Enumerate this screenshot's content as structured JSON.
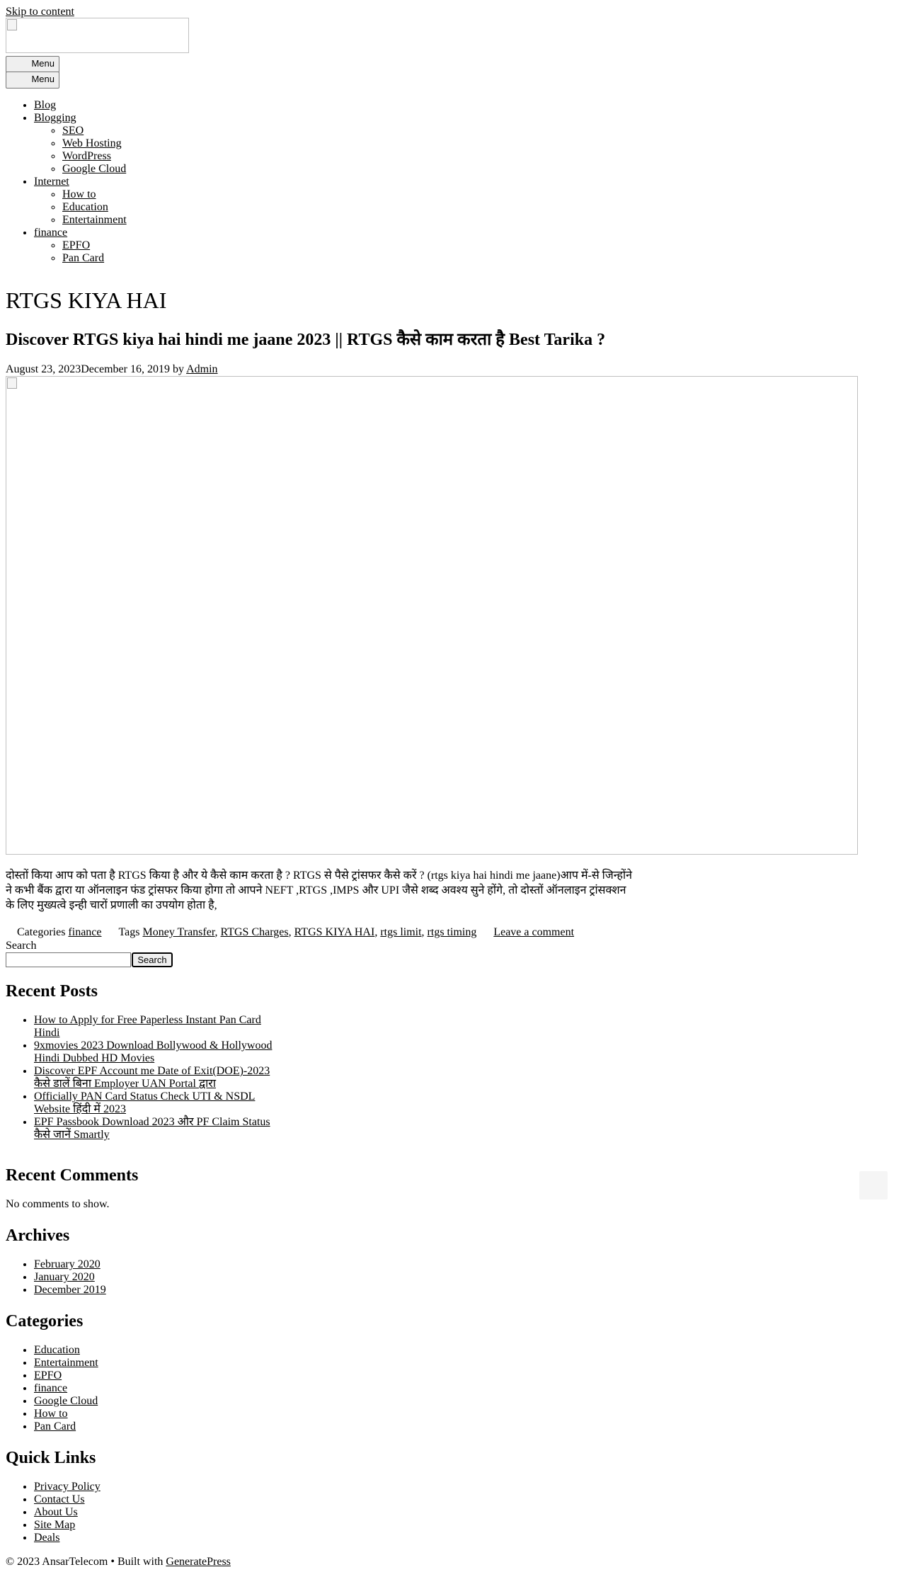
{
  "skip_link": "Skip to content",
  "header": {
    "menu_toggle_1": "Menu",
    "menu_toggle_2": "Menu"
  },
  "nav": {
    "items": [
      {
        "label": "Blog"
      },
      {
        "label": "Blogging",
        "children": [
          "SEO",
          "Web Hosting",
          "WordPress",
          "Google Cloud"
        ]
      },
      {
        "label": "Internet",
        "children": [
          "How to",
          "Education",
          "Entertainment"
        ]
      },
      {
        "label": "finance",
        "children": [
          "EPFO",
          "Pan Card"
        ]
      }
    ]
  },
  "archive_title": "RTGS KIYA HAI",
  "post": {
    "title": "Discover RTGS kiya hai hindi me jaane 2023 || RTGS कैसे काम करता है Best Tarika ?",
    "date_published": "August 23, 2023",
    "date_updated": "December 16, 2019",
    "by": "by",
    "author": "Admin",
    "excerpt": "दोस्तों किया आप को पता है RTGS किया है और ये कैसे काम करता है ? RTGS से पैसे ट्रांसफर कैसे करें ? (rtgs kiya hai hindi me jaane)आप में-से जिन्होंने ने कभी बैंक द्वारा या ऑनलाइन फंड ट्रांसफर किया होगा तो आपने NEFT ,RTGS ,IMPS और UPI जैसे शब्द अवश्य सुने होंगे, तो दोस्तों ऑनलाइन ट्रांसक्शन के लिए मुख्यत्वे इन्ही चारों प्रणाली का उपयोग होता है,",
    "categories_label": "Categories",
    "category": "finance",
    "tags_label": "Tags",
    "tags": [
      "Money Transfer",
      "RTGS Charges",
      "RTGS KIYA HAI",
      "rtgs limit",
      "rtgs timing"
    ],
    "comment_link": "Leave a comment"
  },
  "search": {
    "label": "Search",
    "button": "Search",
    "value": ""
  },
  "recent_posts": {
    "title": "Recent Posts",
    "items": [
      "How to Apply for Free Paperless Instant Pan Card Hindi",
      "9xmovies 2023 Download Bollywood & Hollywood Hindi Dubbed HD Movies",
      "Discover EPF Account me Date of Exit(DOE)-2023 कैसे डालें बिना Employer UAN Portal द्वारा",
      "Officially PAN Card Status Check UTI & NSDL Website हिंदी में 2023",
      "EPF Passbook Download 2023 और PF Claim Status कैसे जानें Smartly"
    ]
  },
  "recent_comments": {
    "title": "Recent Comments",
    "empty": "No comments to show."
  },
  "archives": {
    "title": "Archives",
    "items": [
      "February 2020",
      "January 2020",
      "December 2019"
    ]
  },
  "categories": {
    "title": "Categories",
    "items": [
      "Education",
      "Entertainment",
      "EPFO",
      "finance",
      "Google Cloud",
      "How to",
      "Pan Card"
    ]
  },
  "quick_links": {
    "title": "Quick Links",
    "items": [
      "Privacy Policy",
      "Contact Us",
      "About Us",
      "Site Map",
      "Deals"
    ]
  },
  "footer": {
    "copyright": "© 2023 AnsarTelecom • Built with ",
    "builder": "GeneratePress"
  },
  "colors": {
    "text": "#000000",
    "background": "#ffffff",
    "back_to_top": "#f5f5f5"
  }
}
